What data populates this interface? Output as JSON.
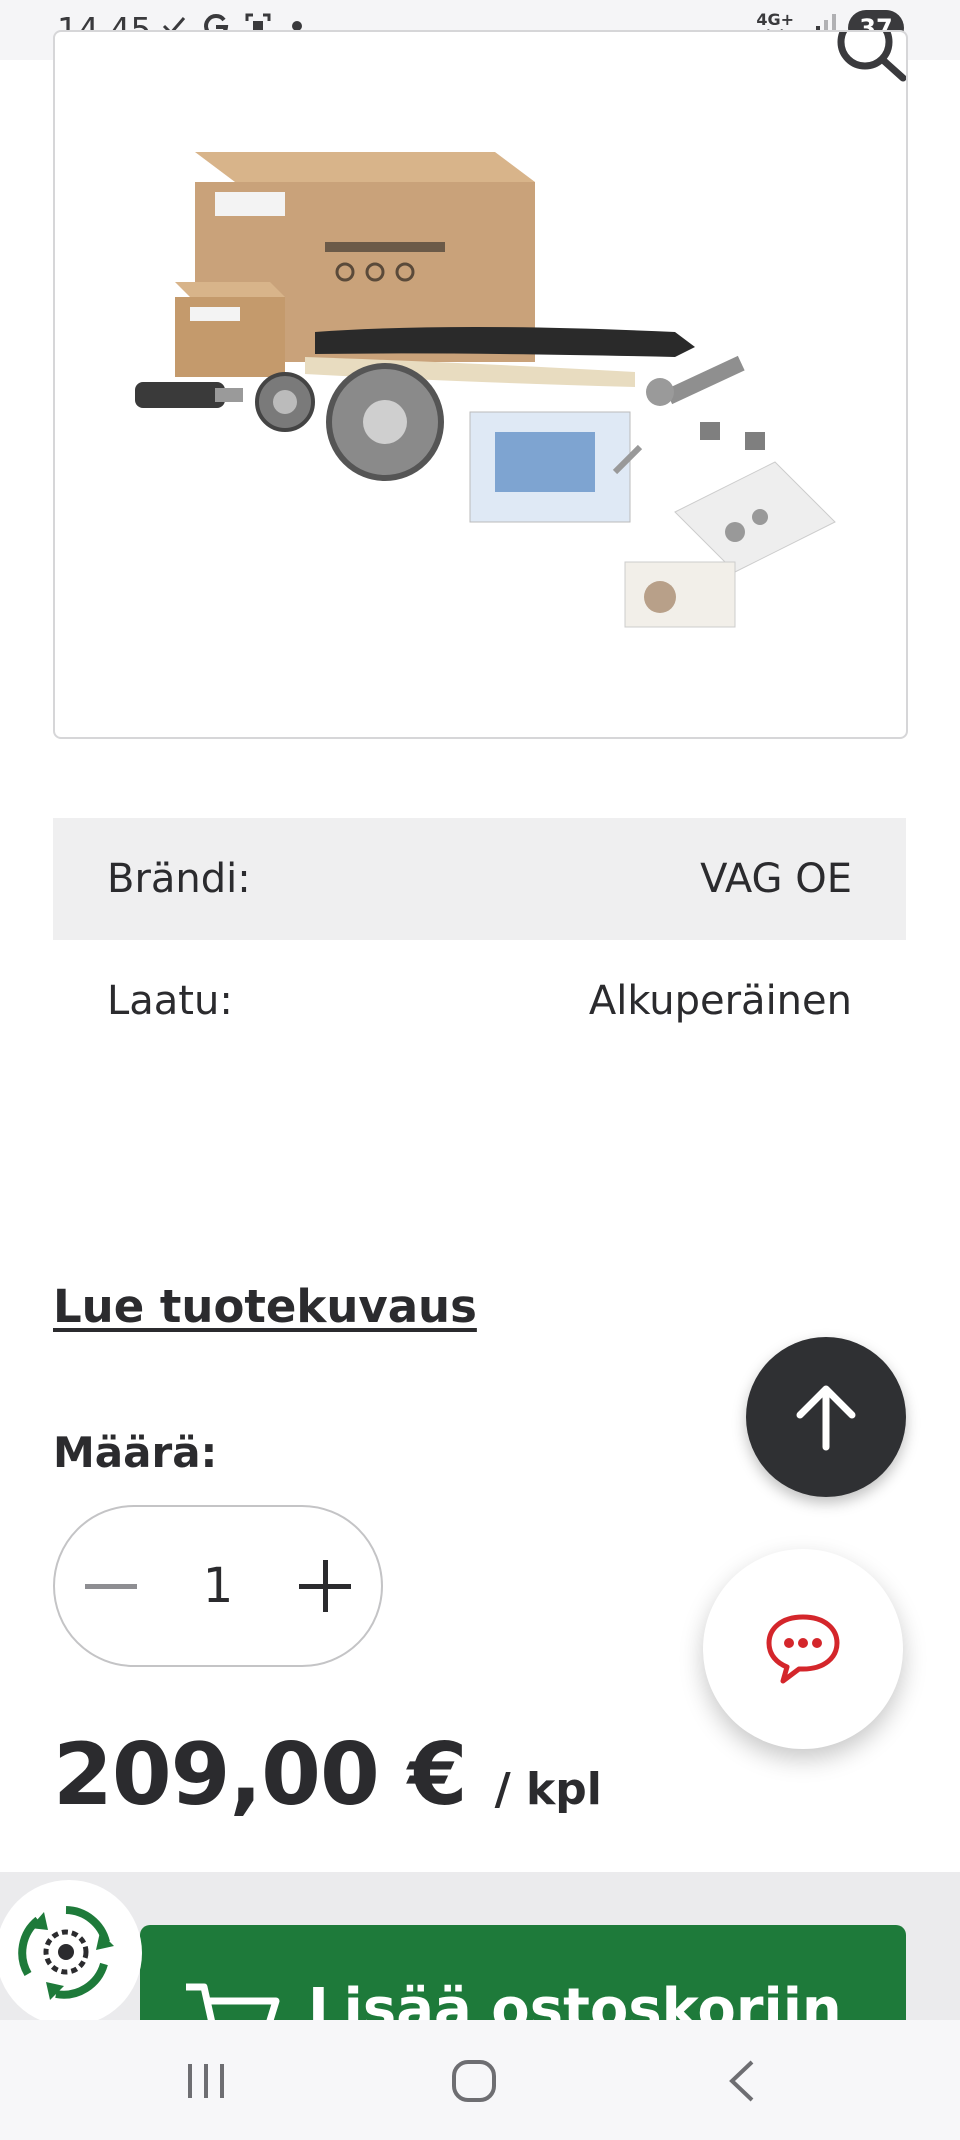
{
  "status_bar": {
    "time": "14.45",
    "network": "4G+",
    "battery": "37"
  },
  "product": {
    "image_alt": "VAG OE timing chain kit"
  },
  "specs": [
    {
      "label": "Brändi:",
      "value": "VAG OE"
    },
    {
      "label": "Laatu:",
      "value": "Alkuperäinen"
    }
  ],
  "read_description_link": "Lue tuotekuvaus",
  "quantity": {
    "label": "Määrä:",
    "value": "1"
  },
  "price": {
    "amount": "209,00 €",
    "unit": "/ kpl"
  },
  "cart_button": {
    "label": "Lisää ostoskoriin"
  },
  "colors": {
    "accent_green": "#1e7a3a",
    "chat_red": "#d4262b",
    "dark": "#2f3033"
  },
  "icons": {
    "zoom": "search-icon",
    "scroll_top": "arrow-up-icon",
    "chat": "chat-bubble-icon",
    "cart": "cart-icon",
    "eco": "recycle-gear-icon"
  }
}
